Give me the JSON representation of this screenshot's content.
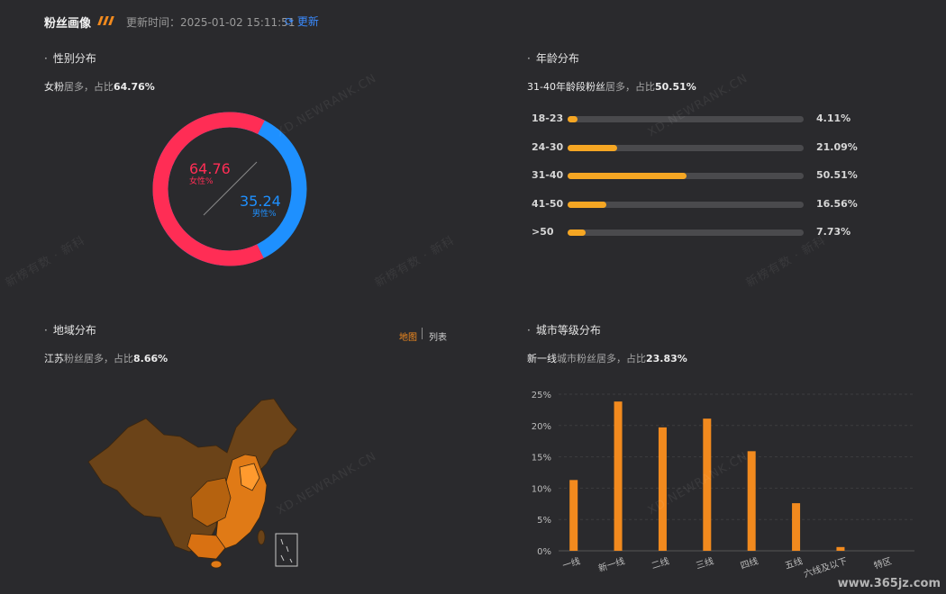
{
  "header": {
    "title": "粉丝画像",
    "update_time": "更新时间：2025-01-02 15:11:51",
    "refresh_label": "更新"
  },
  "gender": {
    "title": "性别分布",
    "summary_lead": "女粉",
    "summary_mid": "居多，占比",
    "summary_value": "64.76%",
    "female_value": "64.76",
    "female_label": "女性%",
    "male_value": "35.24",
    "male_label": "男性%",
    "female_share": 0.6476,
    "female_color": "#ff2d55",
    "male_color": "#1e90ff"
  },
  "age": {
    "title": "年龄分布",
    "summary_lead": "31-40年龄段粉丝",
    "summary_mid": "居多，占比",
    "summary_value": "50.51%",
    "bar_max": 100,
    "rows": [
      {
        "label": "18-23",
        "value": 4.11,
        "text": "4.11%"
      },
      {
        "label": "24-30",
        "value": 21.09,
        "text": "21.09%"
      },
      {
        "label": "31-40",
        "value": 50.51,
        "text": "50.51%"
      },
      {
        "label": "41-50",
        "value": 16.56,
        "text": "16.56%"
      },
      {
        "label": ">50",
        "value": 7.73,
        "text": "7.73%"
      }
    ]
  },
  "region": {
    "title": "地域分布",
    "tab_map": "地图",
    "tab_list": "列表",
    "summary_lead": "江苏",
    "summary_mid": "粉丝居多，占比",
    "summary_value": "8.66%"
  },
  "city": {
    "title": "城市等级分布",
    "summary_lead": "新一线",
    "summary_mid": "城市粉丝居多，占比",
    "summary_value": "23.83%"
  },
  "chart_data": {
    "type": "bar",
    "categories": [
      "一线",
      "新一线",
      "二线",
      "三线",
      "四线",
      "五线",
      "六线及以下",
      "特区"
    ],
    "values": [
      11.3,
      23.83,
      19.7,
      21.1,
      15.9,
      7.6,
      0.6,
      0
    ],
    "ylim": [
      0,
      25
    ],
    "yticks": [
      "0%",
      "5%",
      "10%",
      "15%",
      "20%",
      "25%"
    ],
    "color": "#f28a1e",
    "grid": true
  },
  "watermarks": [
    "XD.NEWRANK.CN",
    "新榜有数 · 新科"
  ],
  "footer_watermark": "www.365jz.com"
}
